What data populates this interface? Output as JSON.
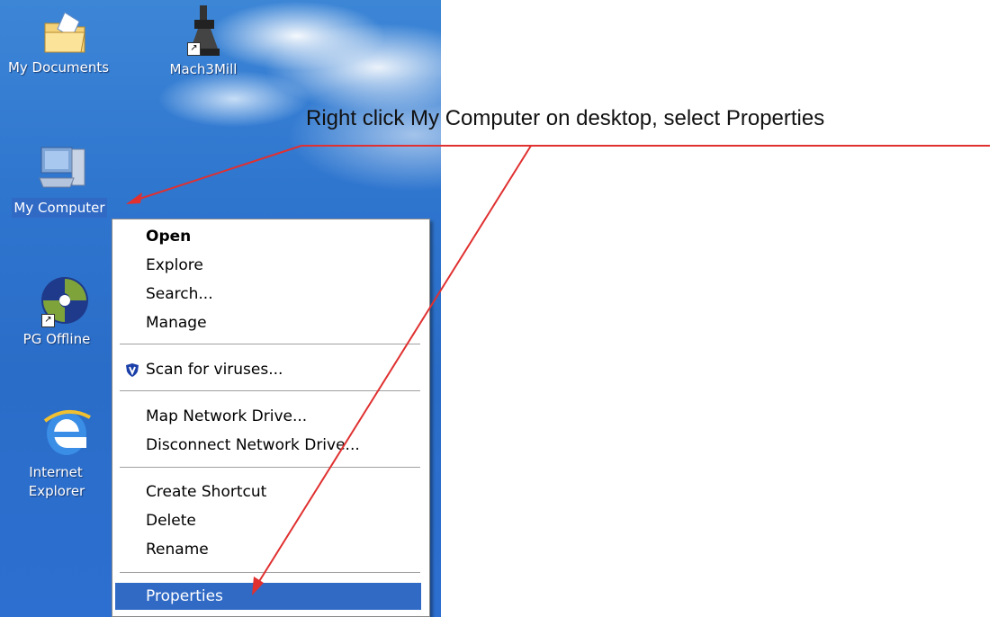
{
  "desktop": {
    "icons": [
      {
        "label": "My Documents"
      },
      {
        "label": "Mach3Mill"
      },
      {
        "label": "My Computer"
      },
      {
        "label": "PG Offline"
      },
      {
        "label_line1": "Internet",
        "label_line2": "Explorer"
      }
    ]
  },
  "menu": {
    "items": [
      {
        "label": "Open"
      },
      {
        "label": "Explore"
      },
      {
        "label": "Search..."
      },
      {
        "label": "Manage"
      },
      {
        "label": "Scan for viruses..."
      },
      {
        "label": "Map Network Drive..."
      },
      {
        "label": "Disconnect Network Drive..."
      },
      {
        "label": "Create Shortcut"
      },
      {
        "label": "Delete"
      },
      {
        "label": "Rename"
      },
      {
        "label": "Properties"
      }
    ]
  },
  "annotation": {
    "caption": "Right click My Computer on desktop, select Properties",
    "color": "#e03030"
  },
  "colors": {
    "selection": "#316ac5",
    "desktop": "#2f76cf"
  }
}
